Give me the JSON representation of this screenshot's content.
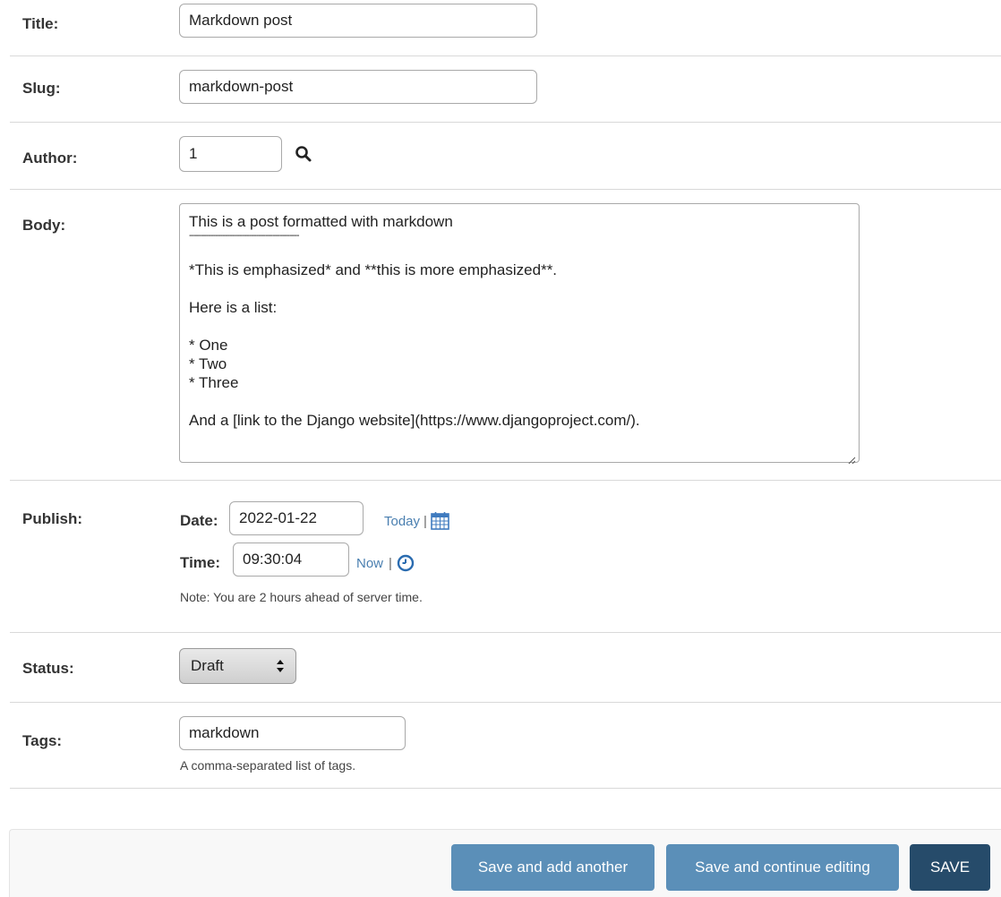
{
  "fields": {
    "title": {
      "label": "Title:",
      "value": "Markdown post"
    },
    "slug": {
      "label": "Slug:",
      "value": "markdown-post"
    },
    "author": {
      "label": "Author:",
      "value": "1",
      "lookup_icon": "search-icon"
    },
    "body": {
      "label": "Body:",
      "lines": [
        "This is a post formatted with markdown",
        "----------------------------------------------",
        "",
        "*This is emphasized* and **this is more emphasized**.",
        "",
        "Here is a list:",
        "",
        "* One",
        "* Two",
        "* Three",
        "",
        "And a [link to the Django website](https://www.djangoproject.com/)."
      ]
    },
    "publish": {
      "label": "Publish:",
      "date_label": "Date:",
      "date_value": "2022-01-22",
      "today_link": "Today",
      "separator": "|",
      "calendar_icon": "calendar-icon",
      "time_label": "Time:",
      "time_value": "09:30:04",
      "now_link": "Now",
      "clock_icon": "clock-icon",
      "note": "Note: You are 2 hours ahead of server time."
    },
    "status": {
      "label": "Status:",
      "value": "Draft",
      "arrow_icon": "up-down-arrows-icon"
    },
    "tags": {
      "label": "Tags:",
      "value": "markdown",
      "help": "A comma-separated list of tags."
    }
  },
  "buttons": {
    "save_add_another": "Save and add another",
    "save_continue": "Save and continue editing",
    "save": "SAVE"
  },
  "colors": {
    "primary_button": "#264b6a",
    "secondary_button": "#5b8fb8",
    "link": "#4a7fb0"
  }
}
